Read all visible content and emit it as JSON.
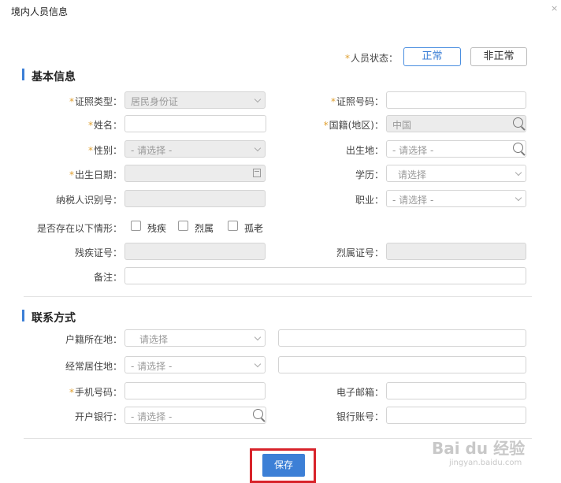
{
  "dialog": {
    "title": "境内人员信息",
    "close_icon": "×"
  },
  "status": {
    "label": "人员状态：",
    "options": [
      "正常",
      "非正常"
    ],
    "selected": "正常"
  },
  "basic": {
    "heading": "基本信息",
    "id_type_label": "证照类型：",
    "id_type_value": "居民身份证",
    "id_no_label": "证照号码：",
    "id_no_value": "",
    "name_label": "姓名：",
    "name_value": "",
    "country_label": "国籍(地区)：",
    "country_value": "中国",
    "gender_label": "性别：",
    "gender_value": "- 请选择 -",
    "birthplace_label": "出生地：",
    "birthplace_value": "- 请选择 -",
    "birthdate_label": "出生日期：",
    "birthdate_value": "",
    "education_label": "学历：",
    "education_value": "请选择",
    "taxid_label": "纳税人识别号：",
    "taxid_value": "",
    "job_label": "职业：",
    "job_value": "- 请选择 -",
    "situation_label": "是否存在以下情形：",
    "situation_options": [
      "残疾",
      "烈属",
      "孤老"
    ],
    "disability_no_label": "残疾证号：",
    "disability_no_value": "",
    "martyr_no_label": "烈属证号：",
    "martyr_no_value": "",
    "remark_label": "备注：",
    "remark_value": ""
  },
  "contact": {
    "heading": "联系方式",
    "household_label": "户籍所在地：",
    "household_value": "请选择",
    "residence_label": "经常居住地：",
    "residence_value": "- 请选择 -",
    "mobile_label": "手机号码：",
    "mobile_value": "",
    "email_label": "电子邮箱：",
    "email_value": "",
    "bank_label": "开户银行：",
    "bank_value": "- 请选择 -",
    "account_label": "银行账号：",
    "account_value": ""
  },
  "footer": {
    "save_label": "保存"
  },
  "watermark": {
    "brand": "Bai du 经验",
    "url": "jingyan.baidu.com"
  },
  "colors": {
    "accent": "#3c7fd6",
    "highlight": "#d8232a",
    "required": "#e0a030"
  }
}
